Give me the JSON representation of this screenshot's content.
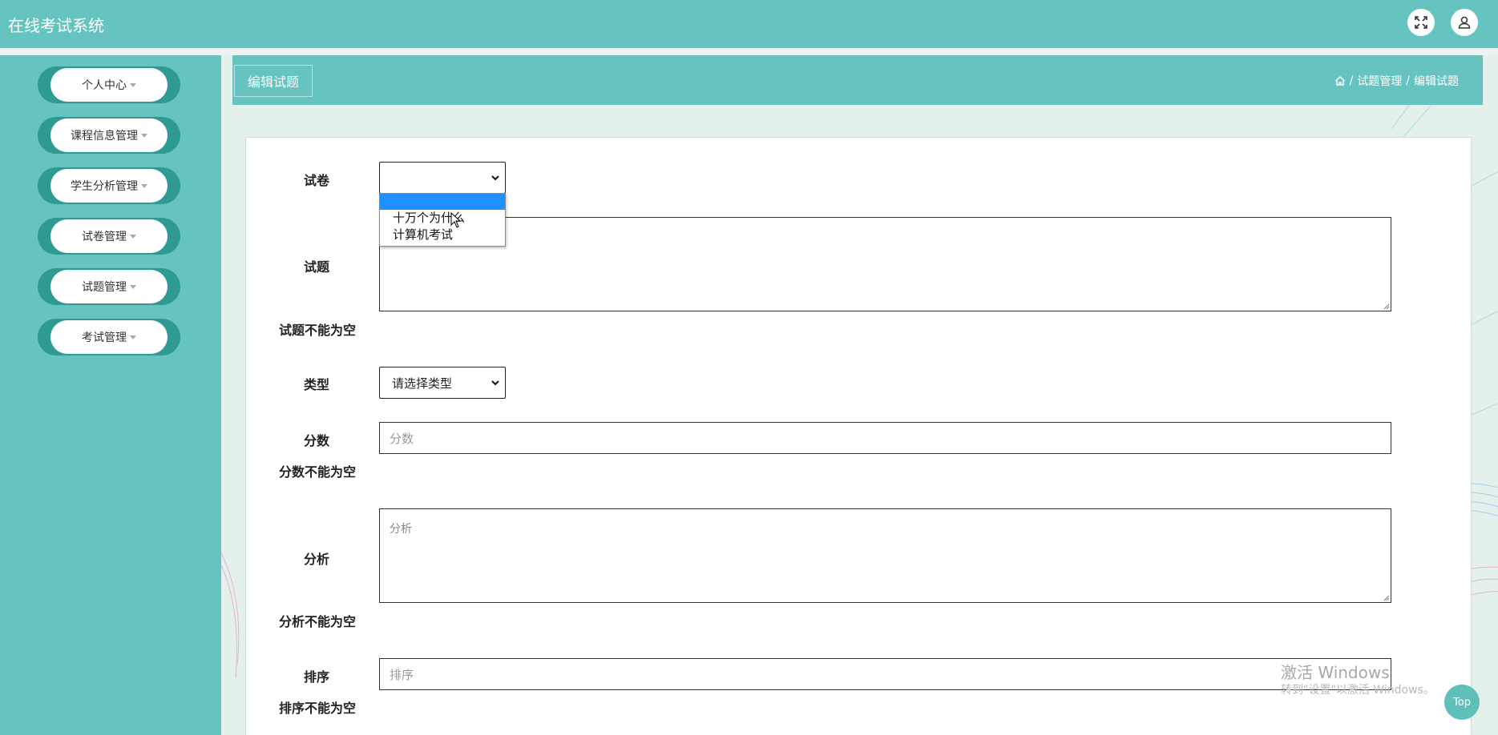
{
  "app": {
    "title": "在线考试系统"
  },
  "sidebar": {
    "items": [
      {
        "label": "个人中心"
      },
      {
        "label": "课程信息管理"
      },
      {
        "label": "学生分析管理"
      },
      {
        "label": "试卷管理"
      },
      {
        "label": "试题管理"
      },
      {
        "label": "考试管理"
      }
    ]
  },
  "header": {
    "page_tab": "编辑试题",
    "breadcrumb": {
      "sep": "/",
      "parent": "试题管理",
      "current": "编辑试题"
    }
  },
  "form": {
    "paper": {
      "label": "试卷",
      "value": "",
      "options": [
        "",
        "十万个为什么",
        "计算机考试"
      ]
    },
    "question": {
      "label": "试题",
      "value": "",
      "error": "试题不能为空"
    },
    "type": {
      "label": "类型",
      "value": "请选择类型"
    },
    "score": {
      "label": "分数",
      "placeholder": "分数",
      "error": "分数不能为空"
    },
    "analysis": {
      "label": "分析",
      "placeholder": "分析",
      "error": "分析不能为空"
    },
    "order": {
      "label": "排序",
      "placeholder": "排序",
      "error": "排序不能为空"
    }
  },
  "overlay": {
    "watermark_title": "激活 Windows",
    "watermark_sub": "转到\"设置\"以激活 Windows。",
    "top_button": "Top"
  },
  "colors": {
    "primary": "#66c4c0",
    "sidebar_pill_edge": "#2f9a92",
    "highlight": "#1e90ff"
  }
}
